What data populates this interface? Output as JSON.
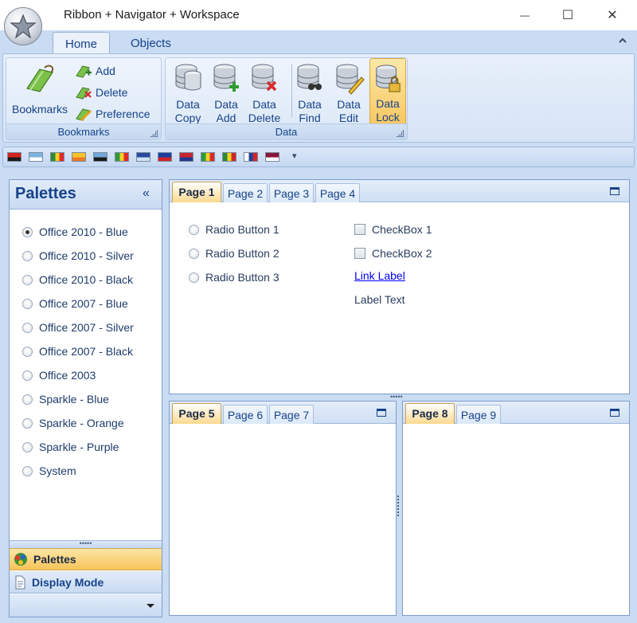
{
  "window": {
    "title": "Ribbon + Navigator + Workspace",
    "controls": {
      "minimize": "—",
      "maximize": "☐",
      "close": "✕"
    }
  },
  "ribbon": {
    "tabs": [
      {
        "label": "Home",
        "active": true
      },
      {
        "label": "Objects",
        "active": false
      }
    ],
    "collapse_icon": "chevron-up",
    "groups": {
      "bookmarks": {
        "label": "Bookmarks",
        "large_button": "Bookmarks",
        "small_buttons": [
          "Add",
          "Delete",
          "Preference"
        ]
      },
      "data": {
        "label": "Data",
        "buttons": [
          {
            "line1": "Data",
            "line2": "Copy",
            "icon": "database-copy-icon"
          },
          {
            "line1": "Data",
            "line2": "Add",
            "icon": "database-add-icon"
          },
          {
            "line1": "Data",
            "line2": "Delete",
            "icon": "database-delete-icon"
          },
          {
            "line1": "Data",
            "line2": "Find",
            "icon": "database-find-icon"
          },
          {
            "line1": "Data",
            "line2": "Edit",
            "icon": "database-edit-icon"
          },
          {
            "line1": "Data",
            "line2": "Lock",
            "icon": "database-lock-icon",
            "selected": true
          }
        ]
      }
    }
  },
  "flag_toolbar": {
    "flags": [
      {
        "name": "albania-flag-icon",
        "colors": [
          "#d0241c",
          "#1a1a1a"
        ]
      },
      {
        "name": "argentina-flag-icon",
        "colors": [
          "#7fb3e0",
          "#ffffff"
        ]
      },
      {
        "name": "benin-flag-icon",
        "colors": [
          "#2f8a3a",
          "#f2d221",
          "#e12a2a"
        ]
      },
      {
        "name": "bhutan-flag-icon",
        "colors": [
          "#f7c525",
          "#ec7a26"
        ]
      },
      {
        "name": "botswana-flag-icon",
        "colors": [
          "#72a7d9",
          "#1a1a1a"
        ]
      },
      {
        "name": "ethiopia-flag-icon",
        "colors": [
          "#2e9b3e",
          "#f2d221",
          "#e12a2a"
        ]
      },
      {
        "name": "falklands-flag-icon",
        "colors": [
          "#2b4a9c",
          "#cfe0f5"
        ]
      },
      {
        "name": "haiti-flag-icon",
        "colors": [
          "#1e3fa0",
          "#d0242a"
        ]
      },
      {
        "name": "laos-flag-icon",
        "colors": [
          "#c8262c",
          "#24368f"
        ]
      },
      {
        "name": "mali-flag-icon",
        "colors": [
          "#2b9c3c",
          "#f2d221",
          "#d82a2a"
        ]
      },
      {
        "name": "mozambique-flag-icon",
        "colors": [
          "#2a8a3a",
          "#f2d221",
          "#d0242a"
        ]
      },
      {
        "name": "panama-flag-icon",
        "colors": [
          "#ffffff",
          "#1f3f9c",
          "#d0242a"
        ]
      },
      {
        "name": "qatar-flag-icon",
        "colors": [
          "#8a1538",
          "#ffffff"
        ]
      }
    ],
    "overflow": "▾"
  },
  "navigator": {
    "title": "Palettes",
    "collapse": "«",
    "options": [
      {
        "label": "Office 2010 - Blue",
        "checked": true
      },
      {
        "label": "Office 2010 - Silver",
        "checked": false
      },
      {
        "label": "Office 2010 - Black",
        "checked": false
      },
      {
        "label": "Office 2007 - Blue",
        "checked": false
      },
      {
        "label": "Office 2007 - Silver",
        "checked": false
      },
      {
        "label": "Office 2007 - Black",
        "checked": false
      },
      {
        "label": "Office 2003",
        "checked": false
      },
      {
        "label": "Sparkle - Blue",
        "checked": false
      },
      {
        "label": "Sparkle - Orange",
        "checked": false
      },
      {
        "label": "Sparkle - Purple",
        "checked": false
      },
      {
        "label": "System",
        "checked": false
      }
    ],
    "grip": "•••••",
    "buttons": [
      {
        "label": "Palettes",
        "active": true,
        "icon": "palette-icon"
      },
      {
        "label": "Display Mode",
        "active": false,
        "icon": "document-icon"
      }
    ]
  },
  "workspace": {
    "cells": [
      {
        "tabs": [
          "Page 1",
          "Page 2",
          "Page 3",
          "Page 4"
        ],
        "active": 0,
        "content": {
          "radios": [
            "Radio Button 1",
            "Radio Button 2",
            "Radio Button 3"
          ],
          "checkboxes": [
            "CheckBox 1",
            "CheckBox 2"
          ],
          "link": "Link Label",
          "label": "Label Text"
        }
      },
      {
        "tabs": [
          "Page 5",
          "Page 6",
          "Page 7"
        ],
        "active": 0
      },
      {
        "tabs": [
          "Page 8",
          "Page 9"
        ],
        "active": 0
      }
    ],
    "splitter_grip": "•••••"
  }
}
